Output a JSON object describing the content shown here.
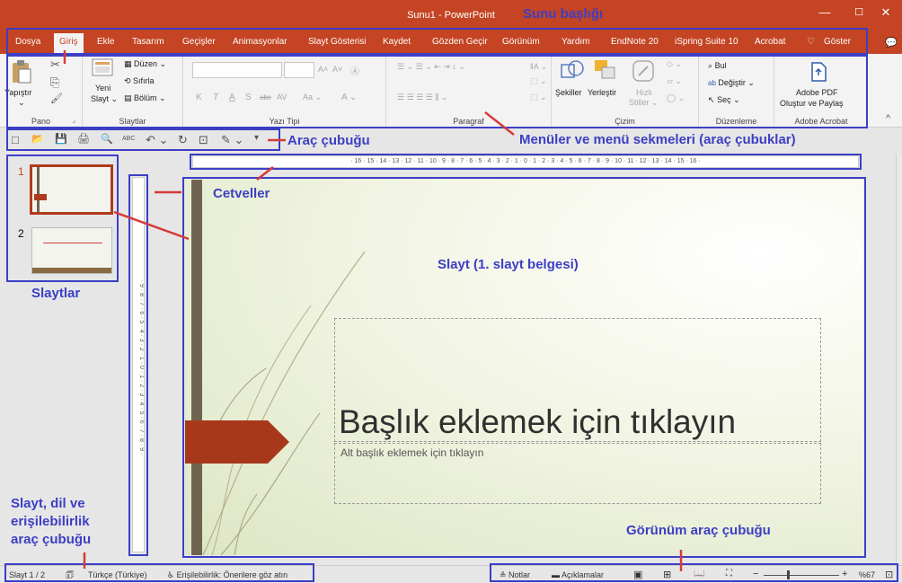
{
  "window": {
    "title": "Sunu1  -  PowerPoint",
    "minimize_icon": "minimize-icon",
    "maximize_icon": "maximize-icon",
    "close_icon": "close-icon",
    "min_glyph": "—",
    "max_glyph": "☐",
    "close_glyph": "✕",
    "comment_glyph": "💬"
  },
  "menu": {
    "tabs": [
      "Dosya",
      "Giriş",
      "Ekle",
      "Tasarım",
      "Geçişler",
      "Animasyonlar",
      "Slayt Gösterisi",
      "Kaydet",
      "Gözden Geçir",
      "Görünüm",
      "Yardım",
      "EndNote 20",
      "iSpring Suite 10",
      "Acrobat",
      "Göster"
    ],
    "active_tab": "Giriş",
    "tell_me_glyph": "♡"
  },
  "ribbon": {
    "pano": {
      "label": "Pano",
      "paste": "Yapıştır",
      "paste_arrow": "⌄",
      "cut_glyph": "✂",
      "copy_glyph": "⎘",
      "painter_glyph": "🖌",
      "launcher_glyph": "⌟"
    },
    "slaytlar": {
      "label": "Slaytlar",
      "new_slide_1": "Yeni",
      "new_slide_2": "Slayt ⌄",
      "layout": "Düzen ⌄",
      "reset": "Sıfırla",
      "section": "Bölüm ⌄"
    },
    "yazi_tipi": {
      "label": "Yazı Tipi",
      "grow": "A˄",
      "shrink": "A˅",
      "clear": "Ⓐ",
      "bold": "K",
      "italic": "T",
      "underline": "A",
      "shadow": "S",
      "strike": "abc",
      "spacing": "AV",
      "case": "Aa ⌄",
      "color": "A ⌄"
    },
    "paragraf": {
      "label": "Paragraf",
      "row1": "☰ ⌄  ☰ ⌄  ⇤ ⇥  ↕ ⌄",
      "row1b": "‖A ⌄",
      "row2": "☰  ☰  ☰  ☰  ⫼ ⌄",
      "row2b": "⬚ ⌄",
      "row3": "⬚ ⌄"
    },
    "cizim": {
      "label": "Çizim",
      "shapes": "Şekiller",
      "arrange": "Yerleştir",
      "quick_styles_1": "Hızlı",
      "quick_styles_2": "Stiller ⌄",
      "fill": "◇ ⌄",
      "outline": "▱ ⌄",
      "effects": "◯ ⌄"
    },
    "duzenleme": {
      "label": "Düzenleme",
      "find": "Bul",
      "replace": "Değiştir ⌄",
      "select": "Seç ⌄",
      "find_glyph": "⌕",
      "replace_glyph": "ab",
      "select_glyph": "↖"
    },
    "adobe": {
      "label": "Adobe Acrobat",
      "btn_1": "Adobe PDF",
      "btn_2": "Oluştur ve Paylaş",
      "collapse_glyph": "^"
    }
  },
  "qat": {
    "icons": [
      "□",
      "📂",
      "💾",
      "🖨",
      "🔍",
      "ABC",
      "↶ ⌄",
      "↻",
      "⊡",
      "✎ ⌄",
      "▾"
    ]
  },
  "thumbnails": [
    "1",
    "2"
  ],
  "rulers": {
    "horizontal": "· 16 · 15 · 14 · 13 · 12 · 11 · 10 · 9 · 8 · 7 · 6 · 5 · 4 · 3 · 2 · 1 · 0 · 1 · 2 · 3 · 4 · 5 · 6 · 7 · 8 · 9 · 10 · 11 · 12 · 13 · 14 · 15 · 16 ·",
    "vertical": "· 9 · 8 · 7 · 6 · 5 · 4 · 3 · 2 · 1 · 0 · 1 · 2 · 3 · 4 · 5 · 6 · 7 · 8 · 9 ·"
  },
  "slide": {
    "title_placeholder": "Başlık eklemek için tıklayın",
    "subtitle_placeholder": "Alt başlık eklemek için tıklayın"
  },
  "statusbar": {
    "slide_count": "Slayt 1 / 2",
    "notes_glyph": "🗊",
    "language": "Türkçe (Türkiye)",
    "accessibility": "Erişilebilirlik: Önerilere göz atın",
    "notes": "≗ Notlar",
    "comments": "▬ Açıklamalar",
    "view_normal": "▣",
    "view_sorter": "⊞",
    "view_reading": "📖",
    "view_slideshow": "⛶",
    "zoom_minus": "−",
    "zoom_plus": "+",
    "zoom": "%67",
    "fit_glyph": "⊡"
  },
  "annotations": {
    "title_bar": "Sunu başlığı",
    "toolbar": "Araç çubuğu",
    "menus": "Menüler ve menü sekmeleri (araç çubuklar)",
    "rulers": "Cetveller",
    "slide": "Slayt (1. slayt belgesi)",
    "slides": "Slaytlar",
    "status_1": "Slayt, dil ve",
    "status_2": "erişilebilirlik",
    "status_3": "araç çubuğu",
    "view_toolbar": "Görünüm araç çubuğu"
  },
  "colors": {
    "accent": "#c44423",
    "annotation": "#3c3fc4",
    "annotation_line": "#d63a3a"
  }
}
